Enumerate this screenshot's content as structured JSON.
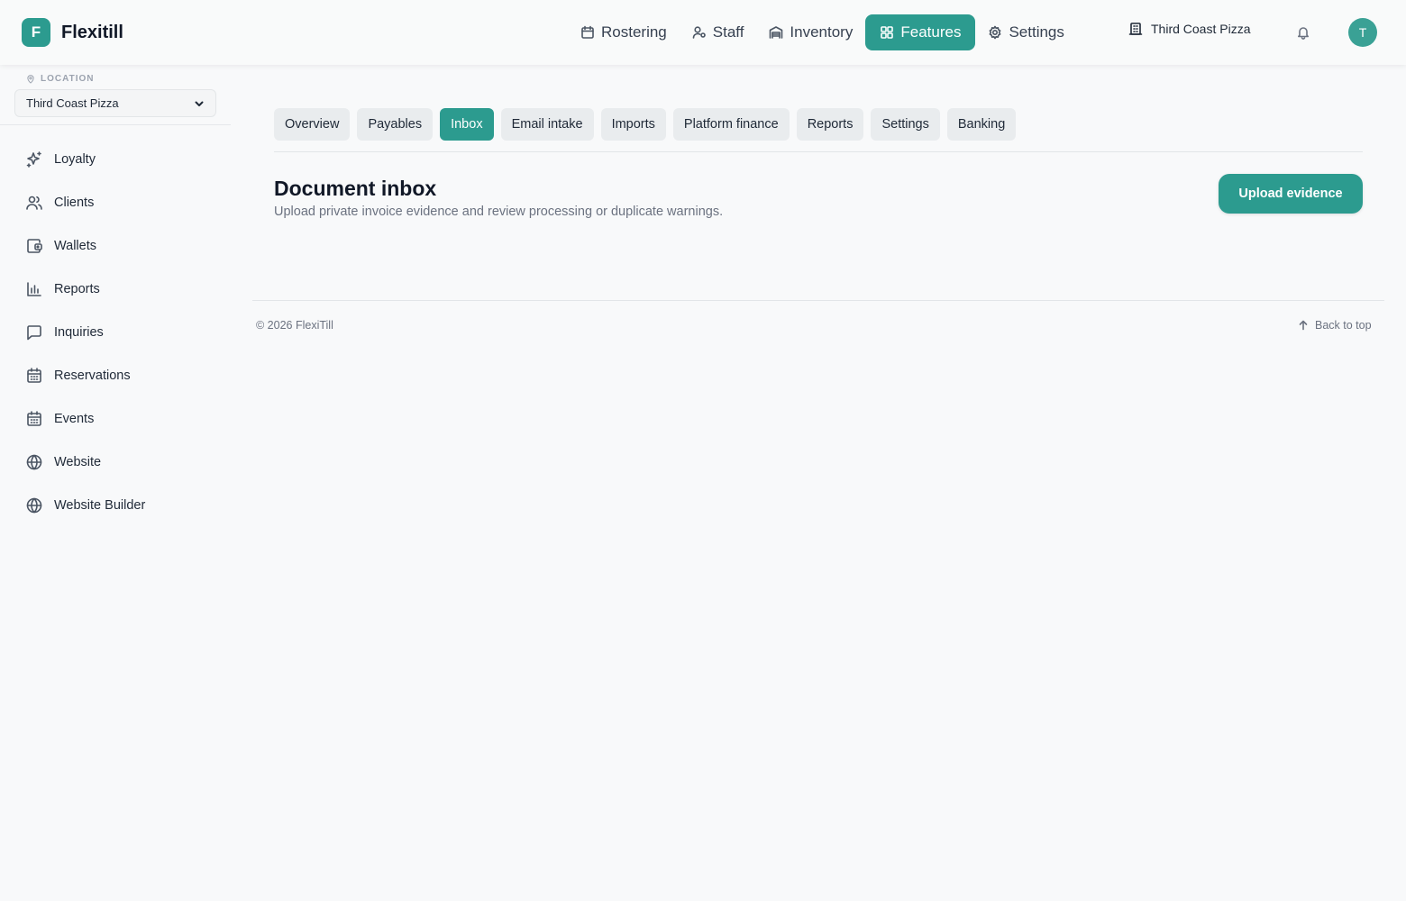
{
  "brand": {
    "mark": "F",
    "name": "Flexitill"
  },
  "topnav": {
    "items": [
      {
        "label": "Rostering",
        "icon": "calendar-icon"
      },
      {
        "label": "Staff",
        "icon": "user-gear-icon"
      },
      {
        "label": "Inventory",
        "icon": "warehouse-icon"
      },
      {
        "label": "Features",
        "icon": "grid-icon",
        "active": true
      },
      {
        "label": "Settings",
        "icon": "gear-icon"
      }
    ],
    "location": "Third Coast Pizza",
    "avatar_initial": "T"
  },
  "sidebar": {
    "location_label": "LOCATION",
    "location_value": "Third Coast Pizza",
    "items": [
      {
        "label": "Loyalty",
        "icon": "sparkles-icon"
      },
      {
        "label": "Clients",
        "icon": "users-icon"
      },
      {
        "label": "Wallets",
        "icon": "wallet-icon"
      },
      {
        "label": "Reports",
        "icon": "bar-chart-icon"
      },
      {
        "label": "Inquiries",
        "icon": "message-icon"
      },
      {
        "label": "Reservations",
        "icon": "calendar-grid-icon"
      },
      {
        "label": "Events",
        "icon": "calendar-grid-icon"
      },
      {
        "label": "Website",
        "icon": "globe-icon"
      },
      {
        "label": "Website Builder",
        "icon": "globe-icon"
      }
    ]
  },
  "tabs": [
    {
      "label": "Overview"
    },
    {
      "label": "Payables"
    },
    {
      "label": "Inbox",
      "active": true
    },
    {
      "label": "Email intake"
    },
    {
      "label": "Imports"
    },
    {
      "label": "Platform finance"
    },
    {
      "label": "Reports"
    },
    {
      "label": "Settings"
    },
    {
      "label": "Banking"
    }
  ],
  "main": {
    "title": "Document inbox",
    "subtitle": "Upload private invoice evidence and review processing or duplicate warnings.",
    "upload_label": "Upload evidence"
  },
  "footer": {
    "copyright": "© 2026 FlexiTill",
    "back_to_top": "Back to top"
  },
  "colors": {
    "accent": "#2c9b8f",
    "background": "#f8f9fa"
  }
}
